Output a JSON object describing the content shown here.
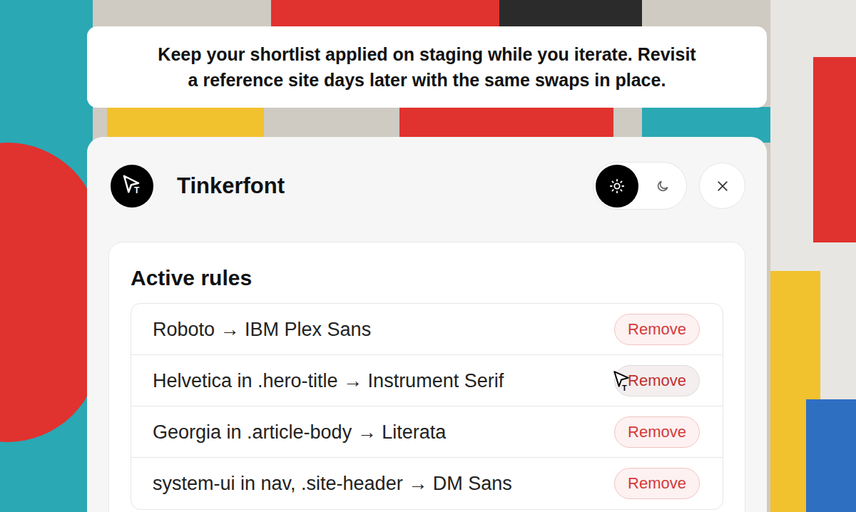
{
  "caption": {
    "lines": [
      "Keep your shortlist applied on staging while you iterate. Revisit",
      "a reference site days later with the same swaps in place."
    ]
  },
  "app": {
    "title": "Tinkerfont",
    "logo_mark": "T"
  },
  "theme_toggle": [
    {
      "kind": "light",
      "selected": true
    },
    {
      "kind": "dark",
      "selected": false
    }
  ],
  "rules": {
    "heading": "Active rules",
    "items": [
      {
        "text": "Roboto → IBM Plex Sans",
        "button": "Remove",
        "hovered": false
      },
      {
        "text": "Helvetica in .hero-title → Instrument Serif",
        "button": "Remove",
        "hovered": true
      },
      {
        "text": "Georgia in .article-body → Literata",
        "button": "Remove",
        "hovered": false
      },
      {
        "text": "system-ui in nav, .site-header → DM Sans",
        "button": "Remove",
        "hovered": false
      }
    ]
  },
  "cursor": {
    "mark": "T"
  }
}
